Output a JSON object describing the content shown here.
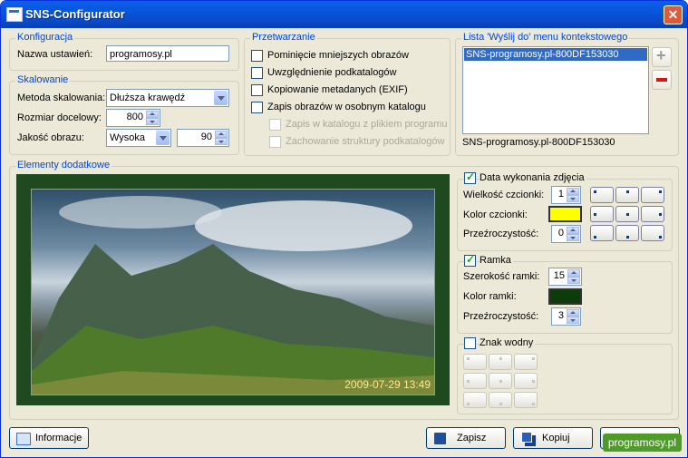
{
  "window": {
    "title": "SNS-Configurator"
  },
  "konfiguracja": {
    "legend": "Konfiguracja",
    "name_label": "Nazwa ustawień:",
    "name_value": "programosy.pl"
  },
  "skalowanie": {
    "legend": "Skalowanie",
    "method_label": "Metoda skalowania:",
    "method_value": "Dłuższa krawędź",
    "size_label": "Rozmiar docelowy:",
    "size_value": "800",
    "quality_label": "Jakość obrazu:",
    "quality_value": "Wysoka",
    "quality_num": "90"
  },
  "przetwarzanie": {
    "legend": "Przetwarzanie",
    "options": [
      {
        "label": "Pominięcie mniejszych obrazów",
        "checked": false,
        "enabled": true
      },
      {
        "label": "Uwzględnienie podkatalogów",
        "checked": false,
        "enabled": true
      },
      {
        "label": "Kopiowanie metadanych (EXIF)",
        "checked": false,
        "enabled": true
      },
      {
        "label": "Zapis obrazów w osobnym katalogu",
        "checked": false,
        "enabled": true
      },
      {
        "label": "Zapis w katalogu z plikiem programu",
        "checked": false,
        "enabled": false
      },
      {
        "label": "Zachowanie struktury podkatalogów",
        "checked": false,
        "enabled": false
      }
    ]
  },
  "lista": {
    "legend": "Lista 'Wyślij do' menu kontekstowego",
    "items": [
      "SNS-programosy.pl-800DF153030"
    ],
    "status": "SNS-programosy.pl-800DF153030"
  },
  "elementy": {
    "legend": "Elementy dodatkowe",
    "timestamp": "2009-07-29 13:49"
  },
  "data": {
    "checkbox_label": "Data wykonania zdjęcia",
    "checked": true,
    "font_size_label": "Wielkość czcionki:",
    "font_size_value": "1",
    "font_color_label": "Kolor czcionki:",
    "font_color": "#ffff00",
    "transparency_label": "Przeźroczystość:",
    "transparency_value": "0"
  },
  "ramka": {
    "checkbox_label": "Ramka",
    "checked": true,
    "width_label": "Szerokość ramki:",
    "width_value": "15",
    "color_label": "Kolor ramki:",
    "color": "#0b3d0b",
    "transparency_label": "Przeźroczystość:",
    "transparency_value": "3"
  },
  "znak": {
    "checkbox_label": "Znak wodny",
    "checked": false
  },
  "buttons": {
    "info": "Informacje",
    "save": "Zapisz",
    "copy": "Kopiuj"
  },
  "watermark": "programosy.pl"
}
